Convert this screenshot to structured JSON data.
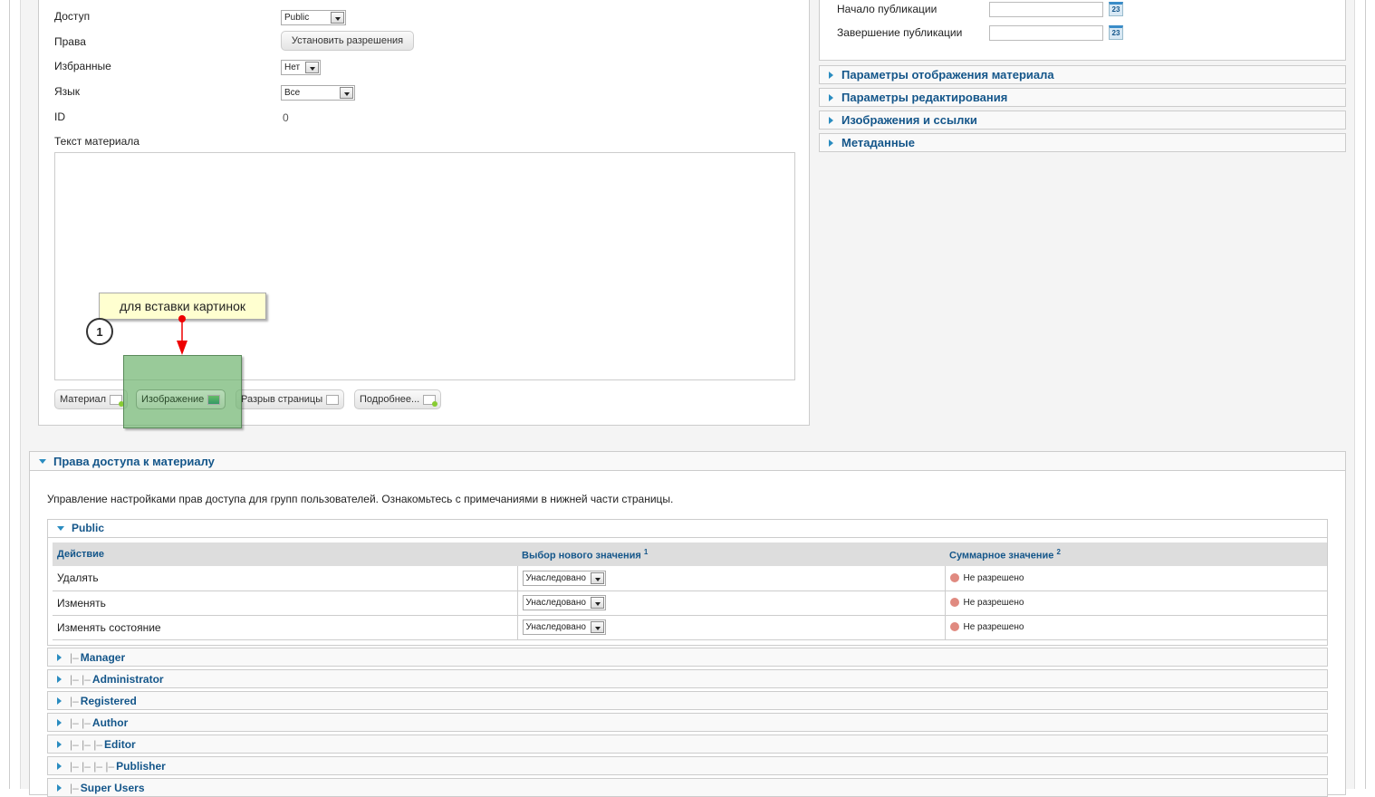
{
  "form": {
    "access_label": "Доступ",
    "access_value": "Public",
    "rights_label": "Права",
    "rights_button": "Установить разрешения",
    "featured_label": "Избранные",
    "featured_value": "Нет",
    "language_label": "Язык",
    "language_value": "Все",
    "id_label": "ID",
    "id_value": "0",
    "text_label": "Текст материала"
  },
  "editor_buttons": [
    "Материал",
    "Изображение",
    "Разрыв страницы",
    "Подробнее..."
  ],
  "annotation": {
    "text": "для вставки картинок",
    "number": "1"
  },
  "publishing": {
    "start_label": "Начало публикации",
    "end_label": "Завершение публикации",
    "calendar_icon_text": "23"
  },
  "right_accordions": [
    "Параметры отображения материала",
    "Параметры редактирования",
    "Изображения и ссылки",
    "Метаданные"
  ],
  "permissions": {
    "title": "Права доступа к материалу",
    "description": "Управление настройками прав доступа для групп пользователей. Ознакомьтесь с примечаниями в нижней части страницы.",
    "group": "Public",
    "columns": {
      "action": "Действие",
      "new_value": "Выбор нового значения",
      "new_value_sup": "1",
      "calc": "Суммарное значение",
      "calc_sup": "2"
    },
    "rows": [
      {
        "action": "Удалять",
        "value": "Унаследовано",
        "calc": "Не разрешено"
      },
      {
        "action": "Изменять",
        "value": "Унаследовано",
        "calc": "Не разрешено"
      },
      {
        "action": "Изменять состояние",
        "value": "Унаследовано",
        "calc": "Не разрешено"
      }
    ],
    "groups": [
      {
        "prefix": "|–",
        "name": "Manager"
      },
      {
        "prefix": "|– |–",
        "name": "Administrator"
      },
      {
        "prefix": "|–",
        "name": "Registered"
      },
      {
        "prefix": "|– |–",
        "name": "Author"
      },
      {
        "prefix": "|– |– |–",
        "name": "Editor"
      },
      {
        "prefix": "|– |– |– |–",
        "name": "Publisher"
      },
      {
        "prefix": "|–",
        "name": "Super Users"
      }
    ]
  },
  "colors": {
    "accent": "#14568a",
    "highlight": "#8cc88c",
    "arrow": "#e00000",
    "note_bg": "#ffffd0"
  }
}
